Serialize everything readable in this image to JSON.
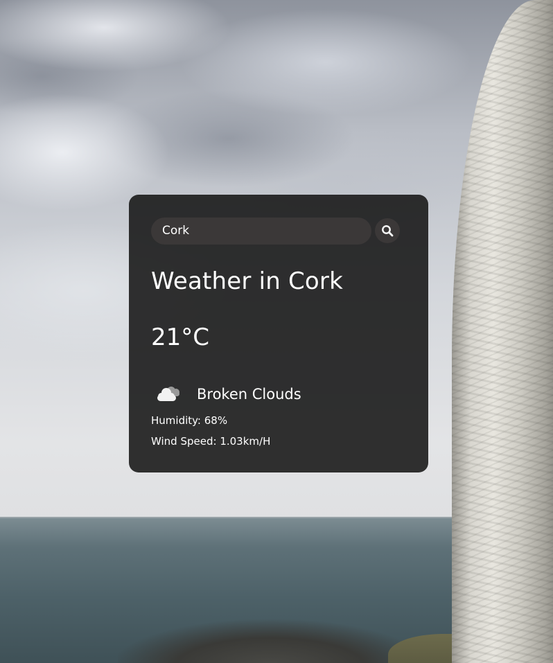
{
  "search": {
    "value": "Cork",
    "icon": "search-icon"
  },
  "weather": {
    "title": "Weather in Cork",
    "temperature": "21°C",
    "condition_icon": "cloud-icon",
    "description": "Broken Clouds",
    "humidity_label": "Humidity: ",
    "humidity_value": "68%",
    "wind_label": "Wind Speed: ",
    "wind_value": "1.03km/H"
  },
  "colors": {
    "card_background": "#161616",
    "input_background": "#3b3838",
    "text": "#ffffff"
  }
}
